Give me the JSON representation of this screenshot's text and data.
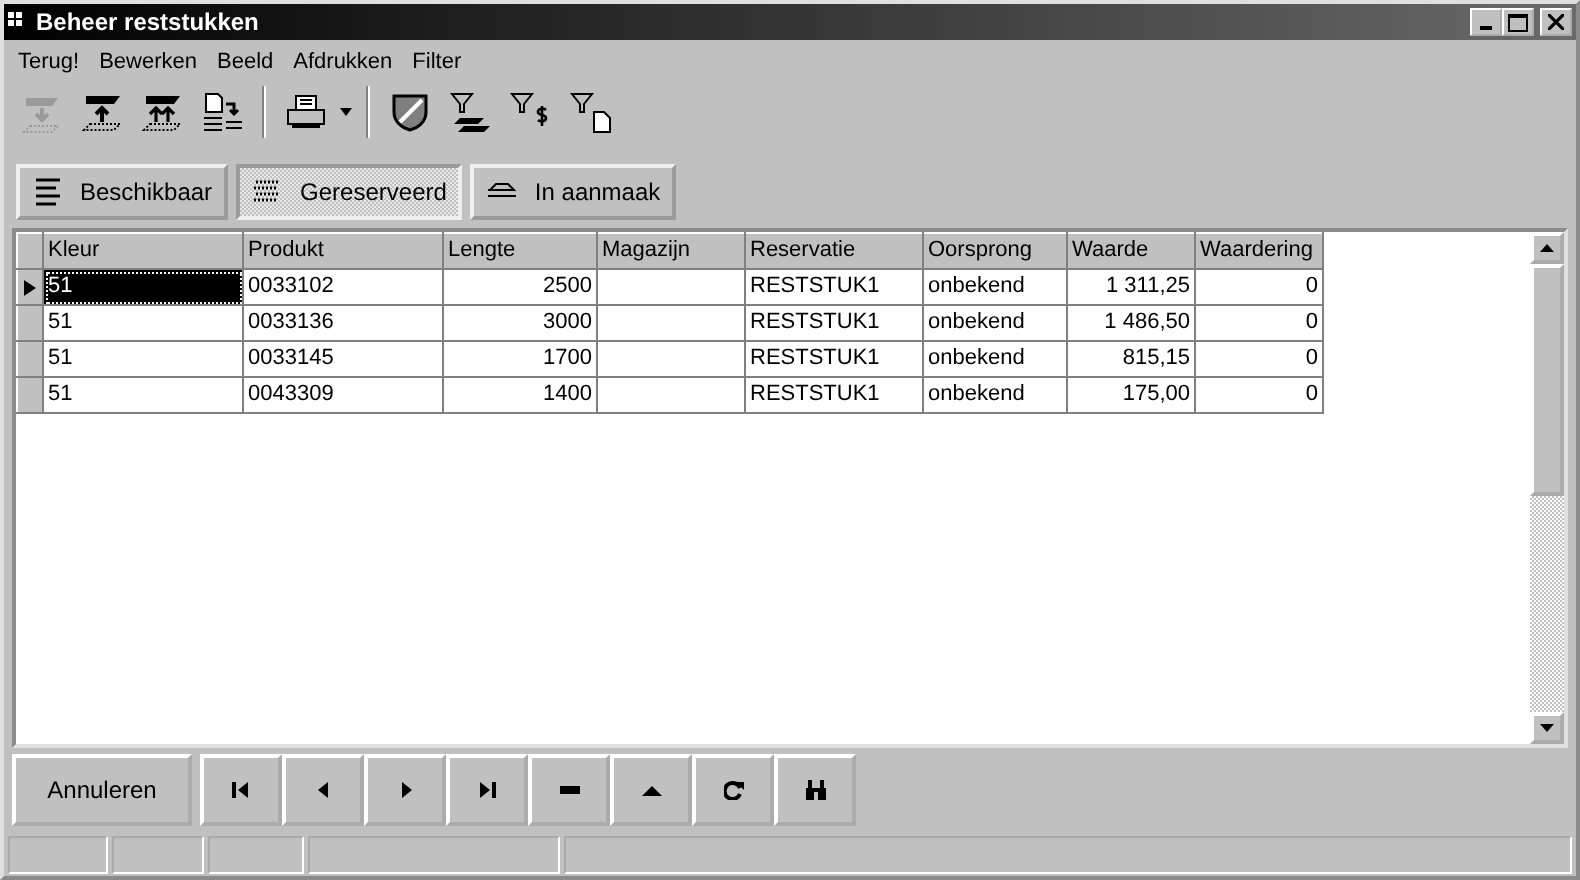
{
  "window": {
    "title": "Beheer reststukken"
  },
  "menu": [
    "Terug!",
    "Bewerken",
    "Beeld",
    "Afdrukken",
    "Filter"
  ],
  "toolbar": [
    {
      "kind": "insert",
      "disabled": true
    },
    {
      "kind": "up",
      "disabled": false
    },
    {
      "kind": "up2",
      "disabled": false
    },
    {
      "kind": "doc-move",
      "disabled": false
    },
    {
      "kind": "sep"
    },
    {
      "kind": "printer",
      "disabled": false
    },
    {
      "kind": "sep"
    },
    {
      "kind": "shield",
      "disabled": false
    },
    {
      "kind": "filter-stack",
      "disabled": false
    },
    {
      "kind": "filter-dollar",
      "disabled": false
    },
    {
      "kind": "filter-doc",
      "disabled": false
    }
  ],
  "tabs": [
    {
      "label": "Beschikbaar",
      "kind": "list",
      "selected": false
    },
    {
      "label": "Gereserveerd",
      "kind": "hatch",
      "selected": true
    },
    {
      "label": "In aanmaak",
      "kind": "build",
      "selected": false
    }
  ],
  "table": {
    "columns": [
      "Kleur",
      "Produkt",
      "Lengte",
      "Magazijn",
      "Reservatie",
      "Oorsprong",
      "Waarde",
      "Waardering"
    ],
    "rows": [
      {
        "current": true,
        "cells": [
          "51",
          "0033102",
          "2500",
          "",
          "RESTSTUK1",
          "onbekend",
          "1 311,25",
          "0"
        ]
      },
      {
        "current": false,
        "cells": [
          "51",
          "0033136",
          "3000",
          "",
          "RESTSTUK1",
          "onbekend",
          "1 486,50",
          "0"
        ]
      },
      {
        "current": false,
        "cells": [
          "51",
          "0033145",
          "1700",
          "",
          "RESTSTUK1",
          "onbekend",
          "815,15",
          "0"
        ]
      },
      {
        "current": false,
        "cells": [
          "51",
          "0043309",
          "1400",
          "",
          "RESTSTUK1",
          "onbekend",
          "175,00",
          "0"
        ]
      }
    ]
  },
  "cancel_button": "Annuleren",
  "navigator": [
    {
      "kind": "first"
    },
    {
      "kind": "prior"
    },
    {
      "kind": "next"
    },
    {
      "kind": "last"
    },
    {
      "kind": "delete"
    },
    {
      "kind": "post"
    },
    {
      "kind": "refresh"
    },
    {
      "kind": "search"
    }
  ]
}
